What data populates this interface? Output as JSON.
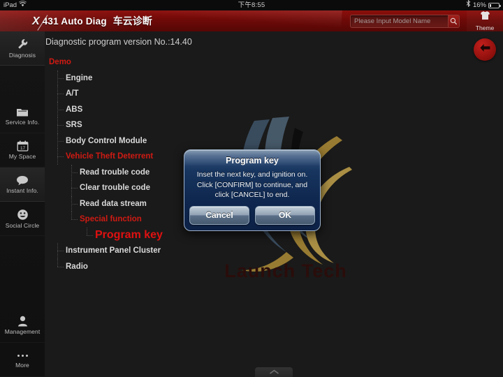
{
  "status_bar": {
    "carrier": "iPad",
    "wifi_icon": "wifi-icon",
    "time": "下午8:55",
    "bluetooth_icon": "bluetooth-icon",
    "battery_percent": "16%",
    "battery_icon": "battery-icon"
  },
  "header": {
    "brand_mark": "X",
    "brand_main": "431 Auto Diag",
    "brand_cn": "车云诊断",
    "search": {
      "placeholder": "Please Input Model Name",
      "value": "",
      "icon": "search-icon"
    },
    "theme": {
      "label": "Theme",
      "icon": "tshirt-icon"
    }
  },
  "sidebar": {
    "items": [
      {
        "label": "Diagnosis",
        "icon": "wrench-icon",
        "active": true
      },
      {
        "label": "Service Info.",
        "icon": "folder-icon",
        "active": false
      },
      {
        "label": "My Space",
        "icon": "calendar-icon",
        "active": false
      },
      {
        "label": "Instant Info.",
        "icon": "chat-bubble-icon",
        "active": true
      },
      {
        "label": "Social Circle",
        "icon": "smiley-icon",
        "active": false
      }
    ],
    "bottom_items": [
      {
        "label": "Management",
        "icon": "person-icon"
      },
      {
        "label": "More",
        "icon": "ellipsis-icon"
      }
    ]
  },
  "main": {
    "version_line": "Diagnostic program version No.:14.40",
    "back_button_icon": "arrow-left-icon",
    "watermark_text": "Launch Tech",
    "tree": [
      {
        "label": "Demo",
        "level": 0,
        "style": "red"
      },
      {
        "label": "Engine",
        "level": 1,
        "style": "normal"
      },
      {
        "label": "A/T",
        "level": 1,
        "style": "normal"
      },
      {
        "label": "ABS",
        "level": 1,
        "style": "normal"
      },
      {
        "label": "SRS",
        "level": 1,
        "style": "normal"
      },
      {
        "label": "Body Control Module",
        "level": 1,
        "style": "normal"
      },
      {
        "label": "Vehicle Theft Deterrent",
        "level": 1,
        "style": "red"
      },
      {
        "label": "Read trouble code",
        "level": 2,
        "style": "normal"
      },
      {
        "label": "Clear trouble code",
        "level": 2,
        "style": "normal"
      },
      {
        "label": "Read data stream",
        "level": 2,
        "style": "normal"
      },
      {
        "label": "Special function",
        "level": 2,
        "style": "red",
        "last": true
      },
      {
        "label": "Program key",
        "level": 3,
        "style": "bigred",
        "last": true
      },
      {
        "label": "Instrument Panel Cluster",
        "level": 1,
        "style": "normal"
      },
      {
        "label": "Radio",
        "level": 1,
        "style": "normal",
        "last": true
      }
    ]
  },
  "dialog": {
    "title": "Program key",
    "message": "Inset the next key, and ignition on. Click [CONFIRM] to continue, and click [CANCEL] to end.",
    "cancel_label": "Cancel",
    "ok_label": "OK"
  },
  "bottom_tab": {
    "icon": "chevron-up-icon"
  },
  "colors": {
    "header_red": "#6e0a08",
    "accent_red": "#cf1a13",
    "highlight_red": "#e01010",
    "dialog_blue": "#17355f",
    "background": "#1a1a1a"
  }
}
